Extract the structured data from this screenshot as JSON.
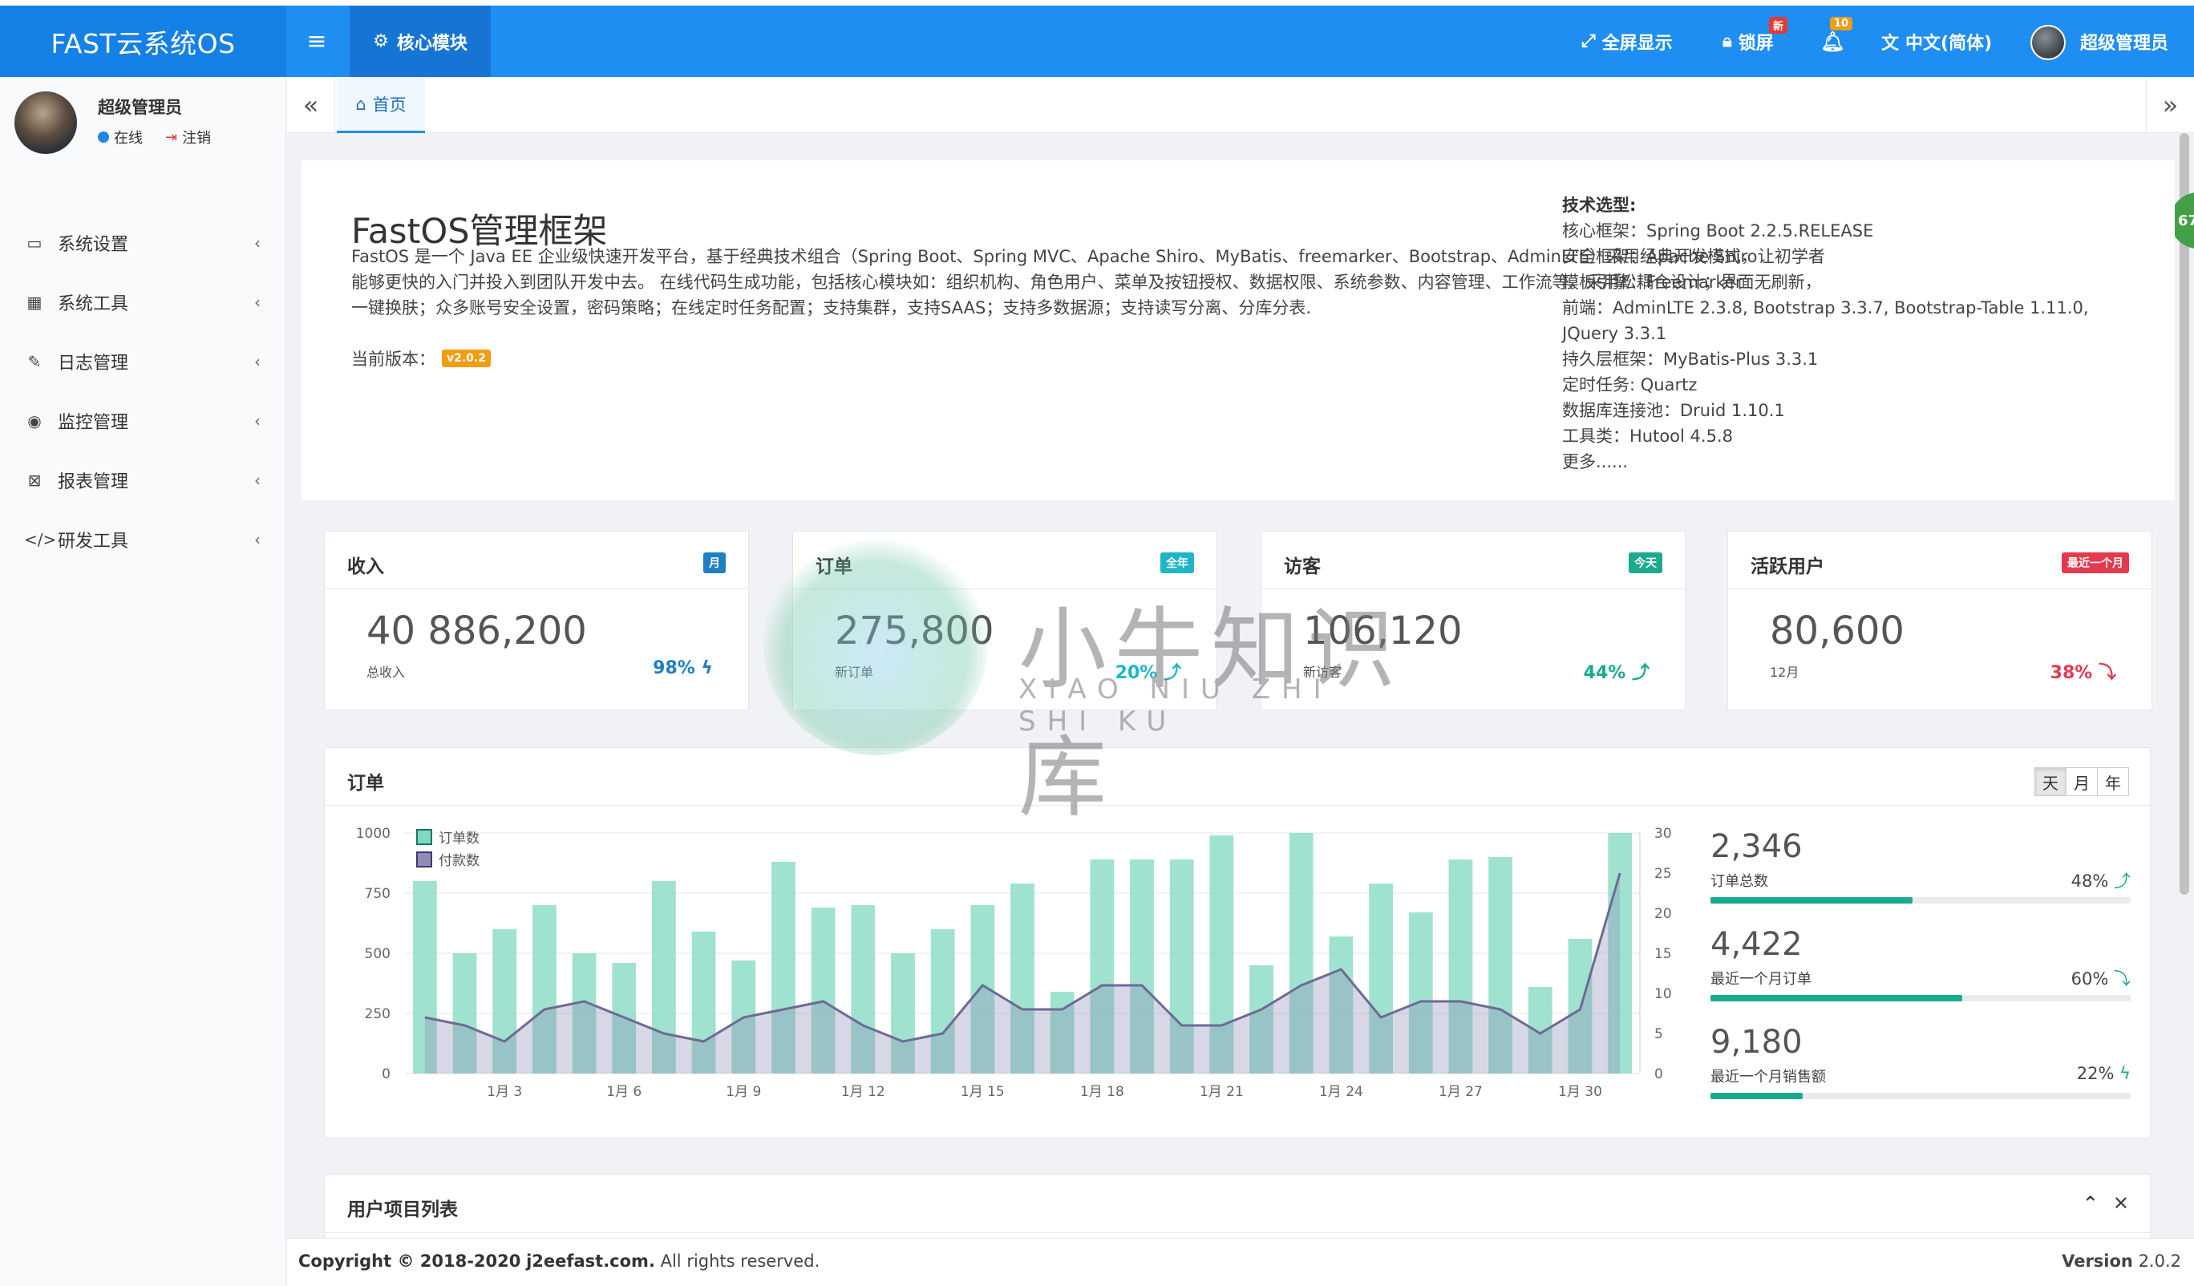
{
  "header": {
    "brand": "FAST云系统OS",
    "menu_icon": "bars-icon",
    "core_tab": "核心模块",
    "fullscreen": "全屏显示",
    "lock": "锁屏",
    "lock_badge": "新",
    "notify_badge": "10",
    "language": "中文(简体)",
    "user": "超级管理员",
    "colors": {
      "bar": "#1e8ef2",
      "brand_bg": "#1581e6",
      "active_tab": "#1675d4"
    }
  },
  "sidebar": {
    "user_name": "超级管理员",
    "status": "在线",
    "logout": "注销",
    "items": [
      {
        "label": "系统设置",
        "icon": "desktop-icon"
      },
      {
        "label": "系统工具",
        "icon": "windows-icon"
      },
      {
        "label": "日志管理",
        "icon": "edit-icon"
      },
      {
        "label": "监控管理",
        "icon": "eye-icon"
      },
      {
        "label": "报表管理",
        "icon": "excel-icon"
      },
      {
        "label": "研发工具",
        "icon": "code-icon"
      }
    ]
  },
  "tabs": {
    "home": "首页"
  },
  "float_badge": "67",
  "intro": {
    "title": "FastOS管理框架",
    "desc": "FastOS 是一个 Java EE 企业级快速开发平台，基于经典技术组合（Spring Boot、Spring MVC、Apache Shiro、MyBatis、freemarker、Bootstrap、AdminLTE）采用经典开发模式，让初学者能够更快的入门并投入到团队开发中去。 在线代码生成功能，包括核心模块如：组织机构、角色用户、菜单及按钮授权、数据权限、系统参数、内容管理、工作流等。采用松耦合设计；界面无刷新，一键换肤；众多账号安全设置，密码策略；在线定时任务配置；支持集群，支持SAAS；支持多数据源；支持读写分离、分库分表.",
    "version_label": "当前版本：",
    "version": "v2.0.2",
    "tech_title": "技术选型:",
    "tech": [
      "核心框架：Spring Boot 2.2.5.RELEASE",
      "安全框架：Apache Shiro",
      "模板引擎：Freemarker",
      "前端：AdminLTE 2.3.8, Bootstrap 3.3.7, Bootstrap-Table 1.11.0, JQuery 3.3.1",
      "持久层框架：MyBatis-Plus 3.3.1",
      "定时任务: Quartz",
      "数据库连接池：Druid 1.10.1",
      "工具类：Hutool 4.5.8",
      "更多......"
    ]
  },
  "cards": [
    {
      "title": "收入",
      "label": "月",
      "label_color": "#1f7fc4",
      "value": "40 886,200",
      "sub": "总收入",
      "pct": "98%",
      "pct_icon": "bolt-icon",
      "pct_color": "#1f7fc4"
    },
    {
      "title": "订单",
      "label": "全年",
      "label_color": "#1fb5c9",
      "value": "275,800",
      "sub": "新订单",
      "pct": "20%",
      "pct_icon": "level-up-icon",
      "pct_color": "#1fb5c9"
    },
    {
      "title": "访客",
      "label": "今天",
      "label_color": "#1aaa8e",
      "value": "106,120",
      "sub": "新访客",
      "pct": "44%",
      "pct_icon": "level-up-icon",
      "pct_color": "#1aaa8e"
    },
    {
      "title": "活跃用户",
      "label": "最近一个月",
      "label_color": "#e53950",
      "value": "80,600",
      "sub": "12月",
      "pct": "38%",
      "pct_icon": "level-down-icon",
      "pct_color": "#e53950"
    }
  ],
  "orders_panel": {
    "title": "订单",
    "ranges": [
      "天",
      "月",
      "年"
    ],
    "active_range": "天",
    "stats": [
      {
        "value": "2,346",
        "label": "订单总数",
        "pct": "48%",
        "icon": "level-up-icon",
        "fill": 0.48
      },
      {
        "value": "4,422",
        "label": "最近一个月订单",
        "pct": "60%",
        "icon": "level-down-icon",
        "fill": 0.6
      },
      {
        "value": "9,180",
        "label": "最近一个月销售额",
        "pct": "22%",
        "icon": "bolt-icon",
        "fill": 0.22
      }
    ]
  },
  "chart_data": {
    "type": "bar",
    "categories": [
      "1月1",
      "1月2",
      "1月3",
      "1月4",
      "1月5",
      "1月6",
      "1月7",
      "1月8",
      "1月9",
      "1月10",
      "1月11",
      "1月12",
      "1月13",
      "1月14",
      "1月15",
      "1月16",
      "1月17",
      "1月18",
      "1月19",
      "1月20",
      "1月21",
      "1月22",
      "1月23",
      "1月24",
      "1月25",
      "1月26",
      "1月27",
      "1月28",
      "1月29",
      "1月30",
      "1月31"
    ],
    "x_tick_labels": [
      "1月 3",
      "1月 6",
      "1月 9",
      "1月 12",
      "1月 15",
      "1月 18",
      "1月 21",
      "1月 24",
      "1月 27",
      "1月 30"
    ],
    "series": [
      {
        "name": "订单数",
        "kind": "bar",
        "axis": "left",
        "color": "#7fd8c0",
        "values": [
          800,
          500,
          600,
          700,
          500,
          460,
          800,
          590,
          470,
          880,
          690,
          700,
          500,
          600,
          700,
          790,
          340,
          890,
          890,
          890,
          990,
          450,
          1000,
          570,
          790,
          670,
          890,
          900,
          360,
          560,
          1000
        ]
      },
      {
        "name": "付款数",
        "kind": "area",
        "axis": "right",
        "color": "#6e6a94",
        "values": [
          7,
          6,
          4,
          8,
          9,
          7,
          5,
          4,
          7,
          8,
          9,
          6,
          4,
          5,
          11,
          8,
          8,
          11,
          11,
          6,
          6,
          8,
          11,
          13,
          7,
          9,
          9,
          8,
          5,
          8,
          25
        ]
      }
    ],
    "y_left": {
      "ticks": [
        0,
        250,
        500,
        750,
        1000
      ],
      "ylim": [
        0,
        1000
      ]
    },
    "y_right": {
      "ticks": [
        0,
        5,
        10,
        15,
        20,
        25,
        30
      ],
      "ylim": [
        0,
        30
      ]
    },
    "legend": "top-left",
    "grid": true
  },
  "user_projects": {
    "title": "用户项目列表",
    "collapse_icon": "chevron-up-icon",
    "close_icon": "close-icon"
  },
  "footer": {
    "copyright_prefix": "Copyright © 2018-2020",
    "domain": "j2eefast.com.",
    "rights": "All rights reserved.",
    "version_label": "Version",
    "version": "2.0.2"
  },
  "watermark": {
    "cn": "小牛知识库",
    "en": "XIAO NIU ZHI SHI KU"
  }
}
